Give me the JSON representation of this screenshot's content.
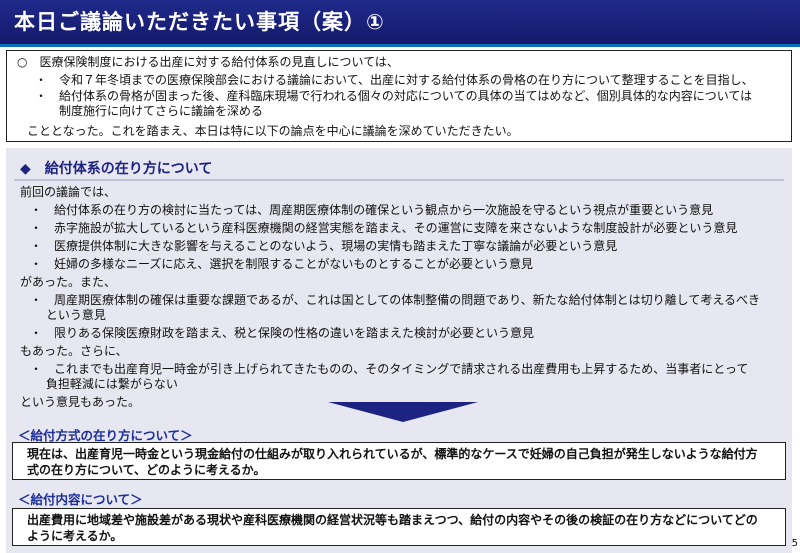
{
  "header": {
    "title": "本日ご議論いただきたい事項（案）①"
  },
  "intro": {
    "lead": "○　医療保険制度における出産に対する給付体系の見直しについては、",
    "bullets": [
      "・　令和７年冬頃までの医療保険部会における議論において、出産に対する給付体系の骨格の在り方について整理することを目指し、",
      "・　給付体系の骨格が固まった後、産科臨床現場で行われる個々の対応についての具体の当てはめなど、個別具体的な内容については",
      "　　制度施行に向けてさらに議論を深める"
    ],
    "closing": "こととなった。これを踏まえ、本日は特に以下の論点を中心に議論を深めていただきたい。"
  },
  "section": {
    "title": "◆　給付体系の在り方について",
    "lines": [
      "前回の議論では、",
      "・　給付体系の在り方の検討に当たっては、周産期医療体制の確保という観点から一次施設を守るという視点が重要という意見",
      "・　赤字施設が拡大しているという産科医療機関の経営実態を踏まえ、その運営に支障を来さないような制度設計が必要という意見",
      "・　医療提供体制に大きな影響を与えることのないよう、現場の実情も踏まえた丁寧な議論が必要という意見",
      "・　妊婦の多様なニーズに応え、選択を制限することがないものとすることが必要という意見",
      "があった。また、",
      "・　周産期医療体制の確保は重要な課題であるが、これは国としての体制整備の問題であり、新たな給付体制とは切り離して考えるべき",
      "　 という意見",
      "・　限りある保険医療財政を踏まえ、税と保険の性格の違いを踏まえた検討が必要という意見",
      "もあった。さらに、",
      "・　これまでも出産育児一時金が引き上げられてきたものの、そのタイミングで請求される出産費用も上昇するため、当事者にとって",
      "　 負担軽減には繋がらない",
      "という意見もあった。"
    ],
    "payment_method": {
      "label": "＜給付方式の在り方について＞",
      "question": [
        "現在は、出産育児一時金という現金給付の仕組みが取り入れられているが、標準的なケースで妊婦の自己負担が発生しないような給付方",
        "式の在り方について、どのように考えるか。"
      ]
    },
    "benefit_content": {
      "label": "＜給付内容について＞",
      "question": [
        "出産費用に地域差や施設差がある現状や産科医療機関の経営状況等も踏まえつつ、給付の内容やその後の検証の在り方などについてどの",
        "ように考えるか。"
      ]
    }
  },
  "footer": {
    "page_number": "5"
  },
  "colors": {
    "title_bg": "#1a2277",
    "accent_blue": "#1e2e9a",
    "panel_bg": "#e7e7f1",
    "arrow": "#1c2380"
  }
}
